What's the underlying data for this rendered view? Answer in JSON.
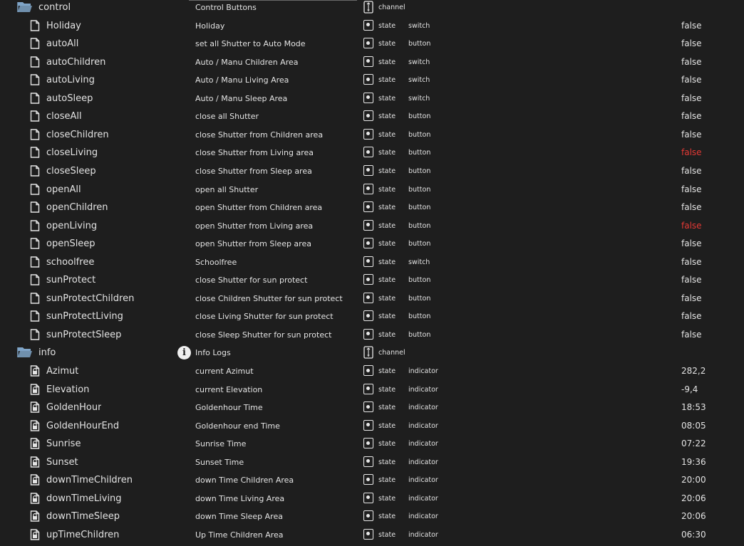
{
  "folders": [
    {
      "name": "control",
      "description": "Control Buttons",
      "type": "channel",
      "icon": "folder-open-icon",
      "items": [
        {
          "name": "Holiday",
          "description": "Holiday",
          "type": "state",
          "role": "switch",
          "value": "false"
        },
        {
          "name": "autoAll",
          "description": "set all Shutter to Auto Mode",
          "type": "state",
          "role": "button",
          "value": "false"
        },
        {
          "name": "autoChildren",
          "description": "Auto / Manu Children Area",
          "type": "state",
          "role": "switch",
          "value": "false"
        },
        {
          "name": "autoLiving",
          "description": "Auto / Manu Living Area",
          "type": "state",
          "role": "switch",
          "value": "false"
        },
        {
          "name": "autoSleep",
          "description": "Auto / Manu Sleep Area",
          "type": "state",
          "role": "switch",
          "value": "false"
        },
        {
          "name": "closeAll",
          "description": "close all Shutter",
          "type": "state",
          "role": "button",
          "value": "false"
        },
        {
          "name": "closeChildren",
          "description": "close Shutter from Children area",
          "type": "state",
          "role": "button",
          "value": "false"
        },
        {
          "name": "closeLiving",
          "description": "close Shutter from Living area",
          "type": "state",
          "role": "button",
          "value": "false",
          "error": true
        },
        {
          "name": "closeSleep",
          "description": "close Shutter from Sleep area",
          "type": "state",
          "role": "button",
          "value": "false"
        },
        {
          "name": "openAll",
          "description": "open all Shutter",
          "type": "state",
          "role": "button",
          "value": "false"
        },
        {
          "name": "openChildren",
          "description": "open Shutter from Children area",
          "type": "state",
          "role": "button",
          "value": "false"
        },
        {
          "name": "openLiving",
          "description": "open Shutter from Living area",
          "type": "state",
          "role": "button",
          "value": "false",
          "error": true
        },
        {
          "name": "openSleep",
          "description": "open Shutter from Sleep area",
          "type": "state",
          "role": "button",
          "value": "false"
        },
        {
          "name": "schoolfree",
          "description": "Schoolfree",
          "type": "state",
          "role": "switch",
          "value": "false"
        },
        {
          "name": "sunProtect",
          "description": "close Shutter for sun protect",
          "type": "state",
          "role": "button",
          "value": "false"
        },
        {
          "name": "sunProtectChildren",
          "description": "close Children Shutter for sun protect",
          "type": "state",
          "role": "button",
          "value": "false"
        },
        {
          "name": "sunProtectLiving",
          "description": "close Living Shutter for sun protect",
          "type": "state",
          "role": "button",
          "value": "false"
        },
        {
          "name": "sunProtectSleep",
          "description": "close Sleep Shutter for sun protect",
          "type": "state",
          "role": "button",
          "value": "false"
        }
      ]
    },
    {
      "name": "info",
      "description": "Info Logs",
      "type": "channel",
      "icon": "folder-open-icon",
      "has_info_icon": true,
      "items": [
        {
          "name": "Azimut",
          "description": "current Azimut",
          "type": "state",
          "role": "indicator",
          "value": "282,2",
          "locked": true
        },
        {
          "name": "Elevation",
          "description": "current Elevation",
          "type": "state",
          "role": "indicator",
          "value": "-9,4",
          "locked": true
        },
        {
          "name": "GoldenHour",
          "description": "Goldenhour Time",
          "type": "state",
          "role": "indicator",
          "value": "18:53",
          "locked": true
        },
        {
          "name": "GoldenHourEnd",
          "description": "Goldenhour end Time",
          "type": "state",
          "role": "indicator",
          "value": "08:05",
          "locked": true
        },
        {
          "name": "Sunrise",
          "description": "Sunrise Time",
          "type": "state",
          "role": "indicator",
          "value": "07:22",
          "locked": true
        },
        {
          "name": "Sunset",
          "description": "Sunset Time",
          "type": "state",
          "role": "indicator",
          "value": "19:36",
          "locked": true
        },
        {
          "name": "downTimeChildren",
          "description": "down Time Children Area",
          "type": "state",
          "role": "indicator",
          "value": "20:00",
          "locked": true
        },
        {
          "name": "downTimeLiving",
          "description": "down Time Living Area",
          "type": "state",
          "role": "indicator",
          "value": "20:06",
          "locked": true
        },
        {
          "name": "downTimeSleep",
          "description": "down Time Sleep Area",
          "type": "state",
          "role": "indicator",
          "value": "20:06",
          "locked": true
        },
        {
          "name": "upTimeChildren",
          "description": "Up Time Children Area",
          "type": "state",
          "role": "indicator",
          "value": "06:30",
          "locked": true
        }
      ]
    }
  ],
  "colors": {
    "background": "#1e1e1e",
    "text": "#e3e3e3",
    "error_value": "#e53935",
    "folder_icon": "#7fa4c7"
  }
}
